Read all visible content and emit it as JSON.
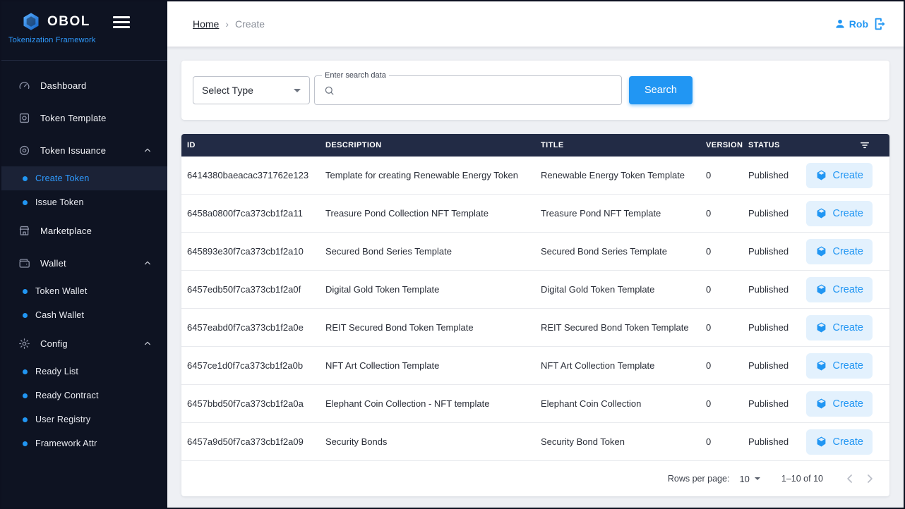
{
  "brand": {
    "name": "OBOL",
    "subtitle": "Tokenization Framework"
  },
  "sidebar": {
    "items": [
      {
        "label": "Dashboard",
        "icon": "dashboard-icon",
        "type": "item"
      },
      {
        "label": "Token Template",
        "icon": "template-icon",
        "type": "item"
      },
      {
        "label": "Token Issuance",
        "icon": "issuance-icon",
        "type": "group",
        "expanded": true
      },
      {
        "label": "Create Token",
        "type": "subitem",
        "active": true
      },
      {
        "label": "Issue Token",
        "type": "subitem"
      },
      {
        "label": "Marketplace",
        "icon": "marketplace-icon",
        "type": "item"
      },
      {
        "label": "Wallet",
        "icon": "wallet-icon",
        "type": "group",
        "expanded": true
      },
      {
        "label": "Token Wallet",
        "type": "subitem"
      },
      {
        "label": "Cash Wallet",
        "type": "subitem"
      },
      {
        "label": "Config",
        "icon": "config-icon",
        "type": "group",
        "expanded": true
      },
      {
        "label": "Ready List",
        "type": "subitem"
      },
      {
        "label": "Ready Contract",
        "type": "subitem"
      },
      {
        "label": "User Registry",
        "type": "subitem"
      },
      {
        "label": "Framework Attr",
        "type": "subitem"
      }
    ]
  },
  "header": {
    "breadcrumb": {
      "home": "Home",
      "separator": "›",
      "current": "Create"
    },
    "user_name": "Rob"
  },
  "search": {
    "select_label": "Select Type",
    "input_label": "Enter search data",
    "input_value": "",
    "button_label": "Search"
  },
  "table": {
    "columns": [
      "ID",
      "DESCRIPTION",
      "TITLE",
      "VERSION",
      "STATUS"
    ],
    "action_label": "Create",
    "rows": [
      {
        "id": "6414380baeacac371762e123",
        "description": "Template for creating Renewable Energy Token",
        "title": "Renewable Energy Token Template",
        "version": "0",
        "status": "Published"
      },
      {
        "id": "6458a0800f7ca373cb1f2a11",
        "description": "Treasure Pond Collection NFT Template",
        "title": "Treasure Pond NFT Template",
        "version": "0",
        "status": "Published"
      },
      {
        "id": "645893e30f7ca373cb1f2a10",
        "description": "Secured Bond Series Template",
        "title": "Secured Bond Series Template",
        "version": "0",
        "status": "Published"
      },
      {
        "id": "6457edb50f7ca373cb1f2a0f",
        "description": "Digital Gold Token Template",
        "title": "Digital Gold Token Template",
        "version": "0",
        "status": "Published"
      },
      {
        "id": "6457eabd0f7ca373cb1f2a0e",
        "description": "REIT Secured Bond Token Template",
        "title": "REIT Secured Bond Token Template",
        "version": "0",
        "status": "Published"
      },
      {
        "id": "6457ce1d0f7ca373cb1f2a0b",
        "description": "NFT Art Collection Template",
        "title": "NFT Art Collection Template",
        "version": "0",
        "status": "Published"
      },
      {
        "id": "6457bbd50f7ca373cb1f2a0a",
        "description": "Elephant Coin Collection - NFT template",
        "title": "Elephant Coin Collection",
        "version": "0",
        "status": "Published"
      },
      {
        "id": "6457a9d50f7ca373cb1f2a09",
        "description": "Security Bonds",
        "title": "Security Bond Token",
        "version": "0",
        "status": "Published"
      }
    ]
  },
  "pagination": {
    "rows_per_page_label": "Rows per page:",
    "rows_per_page_value": "10",
    "range_label": "1–10 of 10"
  },
  "colors": {
    "accent": "#2196f3",
    "sidebar_bg": "#0e1322",
    "table_header_bg": "#222b45",
    "create_button_bg": "#e3f1fd"
  }
}
